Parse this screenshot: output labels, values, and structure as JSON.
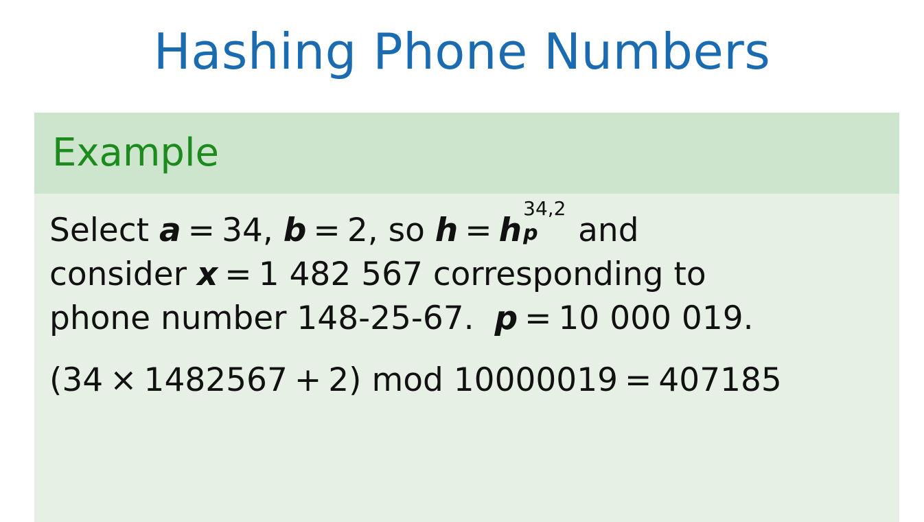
{
  "slide": {
    "title": "Hashing Phone Numbers"
  },
  "example": {
    "header": "Example",
    "line1": {
      "select": "Select",
      "a_var": "a",
      "eq": "=",
      "a_val": "34,",
      "b_var": "b",
      "b_val": "2, so",
      "h_var": "h",
      "hp_var": "h",
      "hp_sup": "34,2",
      "hp_sub": "p",
      "and": "and"
    },
    "line2": {
      "consider": "consider",
      "x_var": "x",
      "eq": "=",
      "x_val": "1 482 567 corresponding to"
    },
    "line3": {
      "phone_text": "phone number 148-25-67.",
      "p_var": "p",
      "eq": "=",
      "p_val": "10 000 019."
    },
    "equation": {
      "lhs_open": "(34",
      "times": "×",
      "mult_val": "1482567",
      "plus": "+",
      "add_val": "2)",
      "mod": "mod 10000019",
      "eq": "=",
      "result": "407185"
    }
  }
}
